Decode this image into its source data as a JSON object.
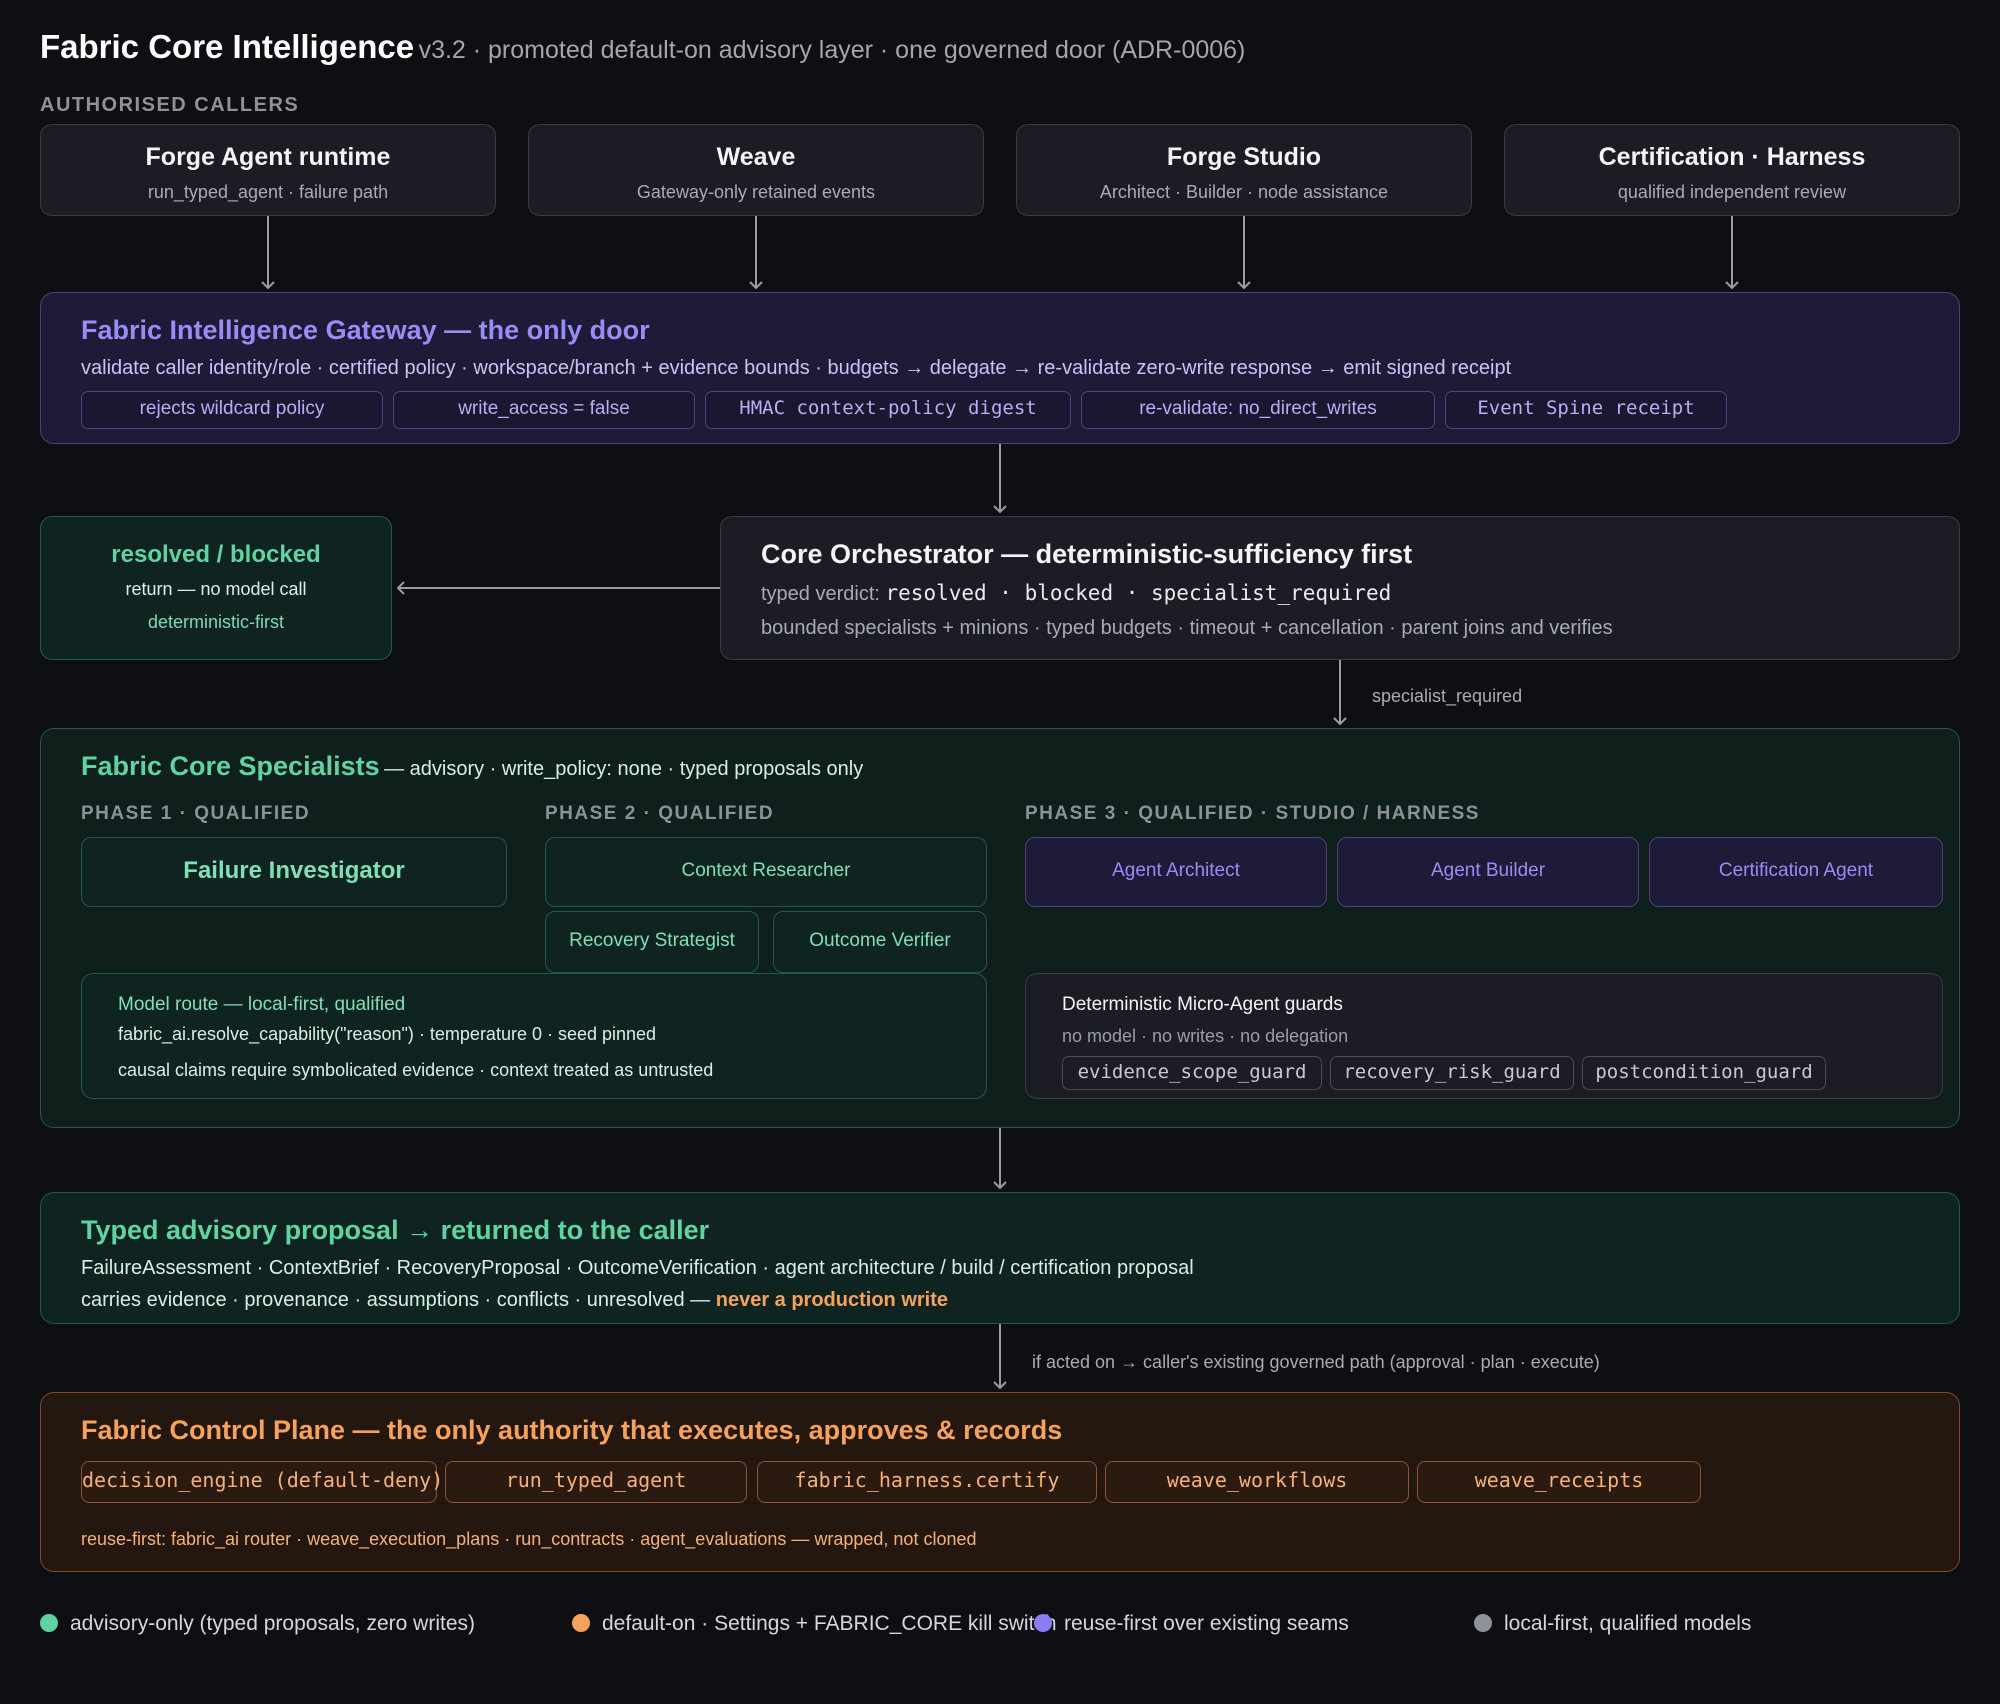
{
  "header": {
    "title": "Fabric Core Intelligence",
    "subtitle": "v3.2 · promoted default-on advisory layer · one governed door (ADR-0006)"
  },
  "callers": {
    "label": "AUTHORISED CALLERS",
    "items": [
      {
        "name": "Forge Agent runtime",
        "desc": "run_typed_agent · failure path"
      },
      {
        "name": "Weave",
        "desc": "Gateway-only retained events"
      },
      {
        "name": "Forge Studio",
        "desc": "Architect · Builder · node assistance"
      },
      {
        "name": "Certification · Harness",
        "desc": "qualified independent review"
      }
    ]
  },
  "gateway": {
    "title": "Fabric Intelligence Gateway — the only door",
    "desc": "validate caller identity/role · certified policy · workspace/branch + evidence bounds · budgets → delegate → re-validate zero-write response → emit signed receipt",
    "chips": [
      "rejects wildcard policy",
      "write_access = false",
      "HMAC context-policy digest",
      "re-validate: no_direct_writes",
      "Event Spine receipt"
    ]
  },
  "resolved": {
    "title": "resolved / blocked",
    "line1": "return — no model call",
    "line2": "deterministic-first"
  },
  "orchestrator": {
    "title": "Core Orchestrator — deterministic-sufficiency first",
    "verdict_label": "typed verdict:",
    "verdict_values": "resolved · blocked · specialist_required",
    "desc": "bounded specialists + minions · typed budgets · timeout + cancellation · parent joins and verifies"
  },
  "edge_label_specialist": "specialist_required",
  "specialists": {
    "title": "Fabric Core Specialists",
    "subtitle": "— advisory · write_policy: none · typed proposals only",
    "phase1": {
      "label": "PHASE 1 · QUALIFIED",
      "agents": [
        "Failure Investigator"
      ]
    },
    "phase2": {
      "label": "PHASE 2 · QUALIFIED",
      "agents": [
        "Context Researcher",
        "Recovery Strategist",
        "Outcome Verifier"
      ]
    },
    "phase3": {
      "label": "PHASE 3 · QUALIFIED · STUDIO / HARNESS",
      "agents": [
        "Agent Architect",
        "Agent Builder",
        "Certification Agent"
      ]
    },
    "model_route": {
      "title": "Model route — local-first, qualified",
      "line1": "fabric_ai.resolve_capability(\"reason\") · temperature 0 · seed pinned",
      "line2": "causal claims require symbolicated evidence · context treated as untrusted"
    },
    "guards": {
      "title": "Deterministic Micro-Agent guards",
      "subtitle": "no model · no writes · no delegation",
      "chips": [
        "evidence_scope_guard",
        "recovery_risk_guard",
        "postcondition_guard"
      ]
    }
  },
  "proposal": {
    "title": "Typed advisory proposal → returned to the caller",
    "line1": "FailureAssessment · ContextBrief · RecoveryProposal · OutcomeVerification · agent architecture / build / certification proposal",
    "line2": "carries evidence · provenance · assumptions · conflicts · unresolved —",
    "line2_warn": "never a production write"
  },
  "edge_label_acted": "if acted on → caller's existing governed path (approval · plan · execute)",
  "control_plane": {
    "title": "Fabric Control Plane — the only authority that executes, approves & records",
    "chips": [
      "decision_engine (default-deny)",
      "run_typed_agent",
      "fabric_harness.certify",
      "weave_workflows",
      "weave_receipts"
    ],
    "footer": "reuse-first: fabric_ai router · weave_execution_plans · run_contracts · agent_evaluations — wrapped, not cloned"
  },
  "legend": [
    {
      "label": "advisory-only (typed proposals, zero writes)",
      "color": "#5fd4a2"
    },
    {
      "label": "default-on · Settings + FABRIC_CORE kill switch",
      "color": "#f7a25c"
    },
    {
      "label": "reuse-first over existing seams",
      "color": "#8b7cf6"
    },
    {
      "label": "local-first, qualified models",
      "color": "#8e9199"
    }
  ],
  "colors": {
    "background": "#0e0f12",
    "advisory_green": "#5fd4a2",
    "gateway_purple": "#9a8cf5",
    "control_orange": "#f7a25c",
    "connector_gray": "#8e9199"
  }
}
